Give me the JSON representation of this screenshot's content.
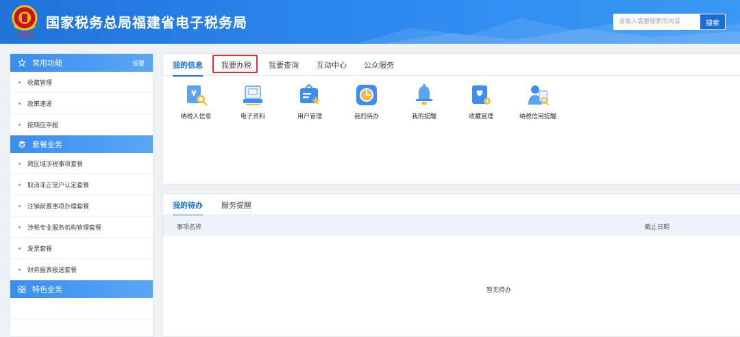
{
  "header": {
    "title": "国家税务总局福建省电子税务局",
    "emblem_text": "中国税务",
    "search_placeholder": "请输入需要搜索的内容",
    "search_button": "搜索"
  },
  "sidebar": {
    "sections": [
      {
        "title": "常用功能",
        "icon": "star-outline-icon",
        "action": "设置",
        "items": [
          "收藏管理",
          "政策速递",
          "按期应申报"
        ]
      },
      {
        "title": "套餐业务",
        "icon": "layers-icon",
        "items": [
          "跨区域涉税事项套餐",
          "取消非正常户认定套餐",
          "注销前置事项办理套餐",
          "涉税专业服务机构管理套餐",
          "发票套餐",
          "财务报表报送套餐"
        ]
      },
      {
        "title": "特色业务",
        "icon": "grid-icon",
        "items": []
      }
    ]
  },
  "main_tabs": [
    "我的信息",
    "我要办税",
    "我要查询",
    "互动中心",
    "公众服务"
  ],
  "active_main_tab": "我的信息",
  "highlighted_tab": "我要办税",
  "functions": [
    {
      "label": "纳税人信息",
      "icon": "taxpayer-info-icon"
    },
    {
      "label": "电子资料",
      "icon": "electronic-data-icon"
    },
    {
      "label": "用户管理",
      "icon": "user-management-icon"
    },
    {
      "label": "我的待办",
      "icon": "clock-todo-icon"
    },
    {
      "label": "我的提醒",
      "icon": "bell-icon"
    },
    {
      "label": "收藏管理",
      "icon": "favorites-icon"
    },
    {
      "label": "纳税信用提醒",
      "icon": "credit-reminder-icon"
    }
  ],
  "todo_panel": {
    "tabs": [
      "我的待办",
      "服务提醒"
    ],
    "active_tab": "我的待办",
    "columns": [
      "事项名称",
      "截止日期"
    ],
    "empty_text": "暂无待办"
  },
  "colors": {
    "header_blue": "#1f73d9",
    "accent": "#1a6fd6",
    "highlight_red": "#e52a2a"
  }
}
